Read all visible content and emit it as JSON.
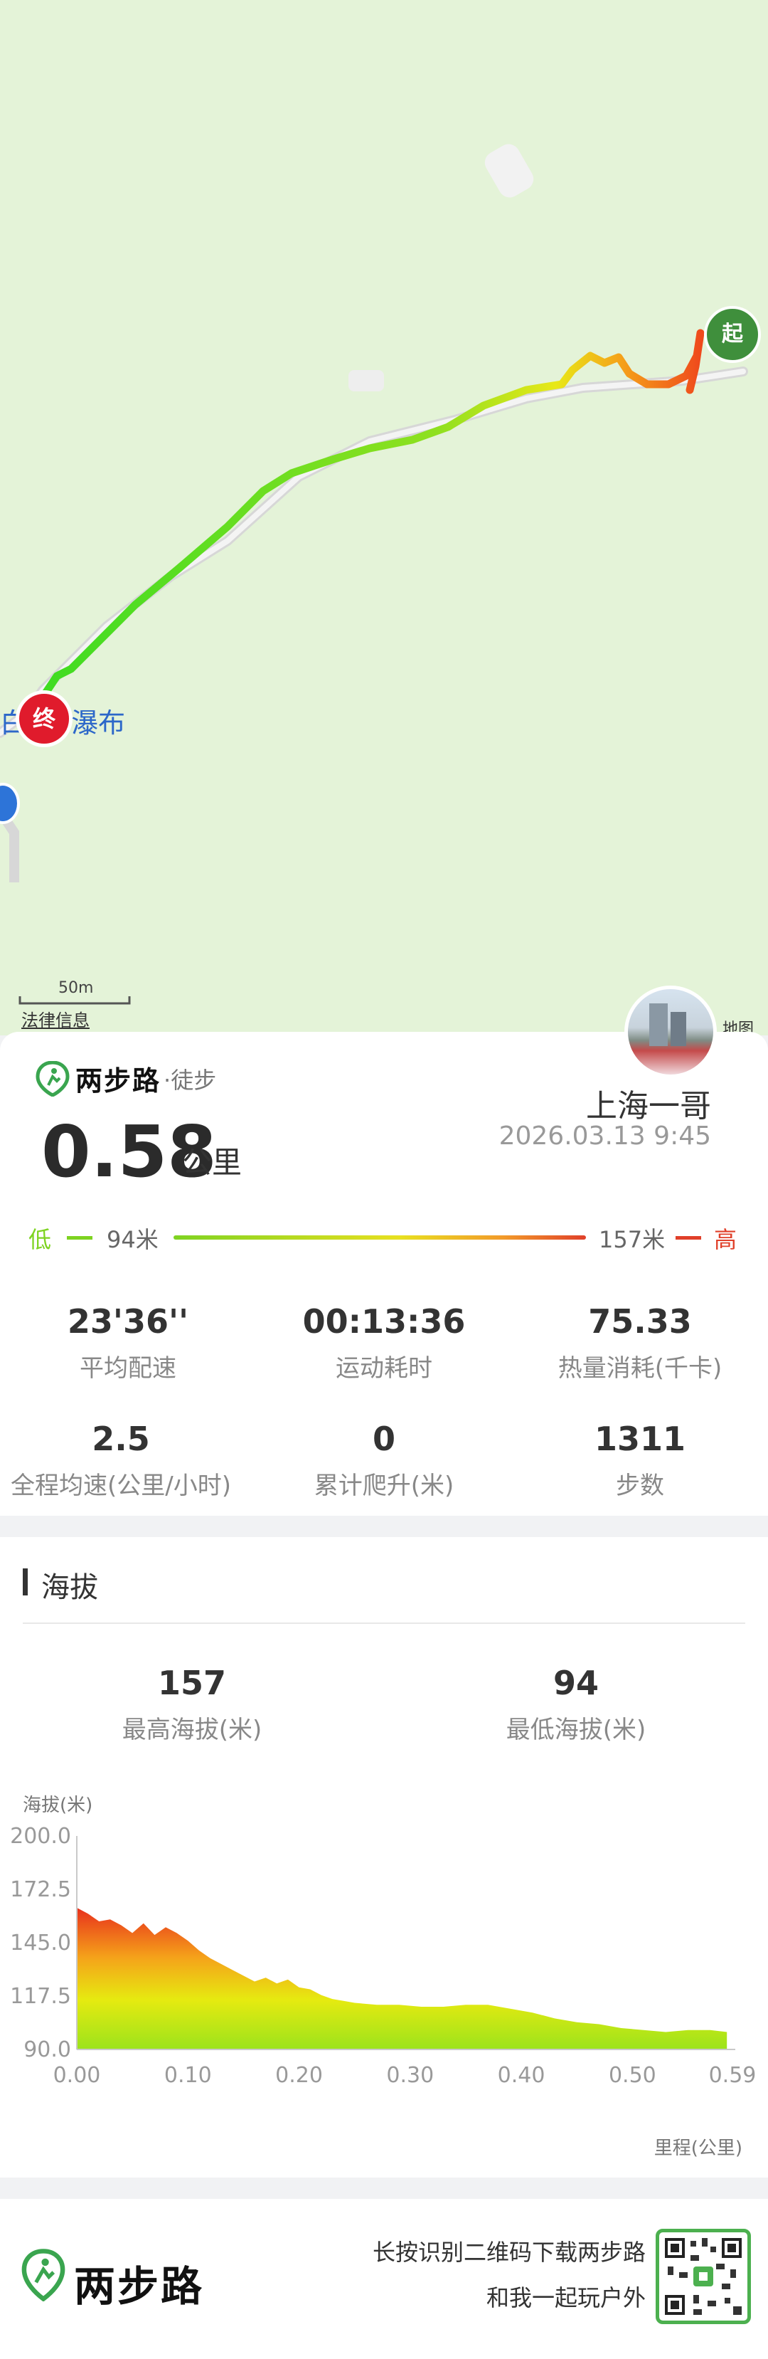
{
  "map": {
    "end_marker": "终",
    "start_marker": "起",
    "poi_left": "白",
    "poi_right": "瀑布",
    "scale_label": "50m",
    "legal_info": "法律信息",
    "map_brand": "地图"
  },
  "summary": {
    "brand": "两步路",
    "activity": "·徒步",
    "distance_value": "0.58",
    "distance_unit": "公里",
    "user_name": "上海一哥",
    "datetime": "2026.03.13 9:45",
    "legend_low": "低",
    "legend_low_value": "94米",
    "legend_high_value": "157米",
    "legend_high": "高",
    "stats": [
      {
        "value": "23'36''",
        "label": "平均配速"
      },
      {
        "value": "00:13:36",
        "label": "运动耗时"
      },
      {
        "value": "75.33",
        "label": "热量消耗(千卡)"
      },
      {
        "value": "2.5",
        "label": "全程均速(公里/小时)"
      },
      {
        "value": "0",
        "label": "累计爬升(米)"
      },
      {
        "value": "1311",
        "label": "步数"
      }
    ]
  },
  "elevation": {
    "section_title": "海拔",
    "max_value": "157",
    "max_label": "最高海拔(米)",
    "min_value": "94",
    "min_label": "最低海拔(米)",
    "y_axis_title": "海拔(米)",
    "x_axis_title": "里程(公里)",
    "y_ticks": [
      "200.0",
      "172.5",
      "145.0",
      "117.5",
      "90.0"
    ],
    "x_ticks": [
      "0.00",
      "0.10",
      "0.20",
      "0.30",
      "0.40",
      "0.50",
      "0.59"
    ]
  },
  "chart_data": {
    "type": "area",
    "xlabel": "里程(公里)",
    "ylabel": "海拔(米)",
    "xlim": [
      0,
      0.59
    ],
    "ylim": [
      90,
      200
    ],
    "x": [
      0.0,
      0.01,
      0.02,
      0.03,
      0.04,
      0.05,
      0.06,
      0.07,
      0.08,
      0.09,
      0.1,
      0.11,
      0.12,
      0.13,
      0.14,
      0.15,
      0.16,
      0.17,
      0.18,
      0.19,
      0.2,
      0.21,
      0.22,
      0.23,
      0.24,
      0.25,
      0.27,
      0.29,
      0.31,
      0.33,
      0.35,
      0.37,
      0.39,
      0.41,
      0.43,
      0.45,
      0.47,
      0.49,
      0.51,
      0.53,
      0.55,
      0.57,
      0.585
    ],
    "y": [
      163,
      160,
      156,
      157,
      154,
      150,
      155,
      149,
      153,
      150,
      146,
      141,
      137,
      134,
      131,
      128,
      125,
      127,
      124,
      126,
      122,
      121,
      118,
      116,
      115,
      114,
      113,
      113,
      112,
      112,
      113,
      113,
      111,
      109,
      106,
      104,
      103,
      101,
      100,
      99,
      100,
      100,
      99
    ]
  },
  "footer": {
    "brand": "两步路",
    "line1": "长按识别二维码下载两步路",
    "line2": "和我一起玩户外"
  },
  "colors": {
    "low": "#7ed321",
    "high": "#e0402a",
    "track_green": "#66e020",
    "brand_green": "#3aa54f"
  }
}
